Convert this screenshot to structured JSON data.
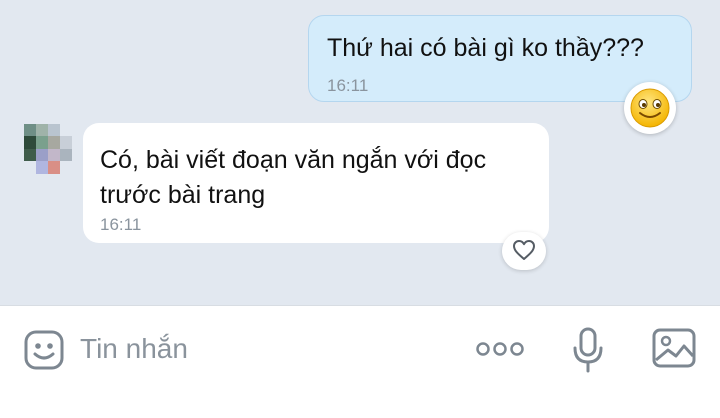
{
  "messages": {
    "sent": {
      "text": "Thứ hai có bài gì ko thầy???",
      "time": "16:11",
      "reaction_icon": "smiley-emoji-icon"
    },
    "received": {
      "text": "Có, bài viết đoạn văn ngắn với đọc trước bài trang",
      "time": "16:11",
      "reaction_icon": "heart-icon"
    }
  },
  "input_bar": {
    "placeholder": "Tin nhắn",
    "icons": [
      "emoji-sticker-icon",
      "more-dots-icon",
      "microphone-icon",
      "image-gallery-icon"
    ]
  },
  "colors": {
    "chat_background": "#e2e8f0",
    "sent_bubble": "#d4ecfb",
    "received_bubble": "#ffffff",
    "timestamp": "#8a949e",
    "icon_gray": "#7d8791"
  }
}
